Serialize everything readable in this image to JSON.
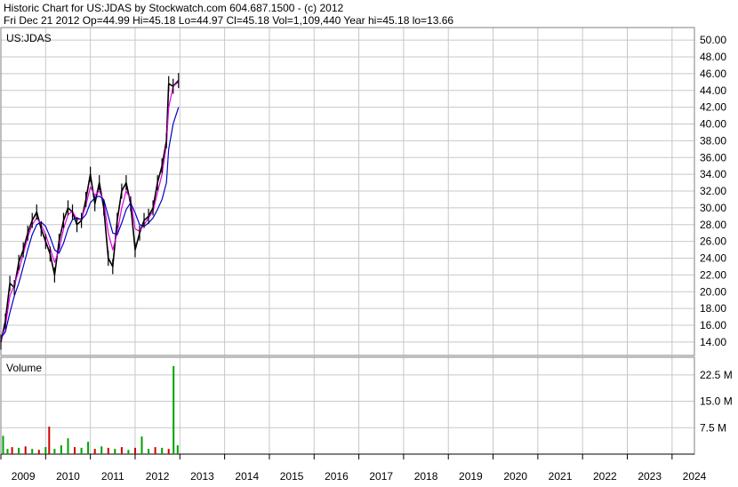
{
  "header": {
    "line1": "Historic Chart for US:JDAS by Stockwatch.com 604.687.1500 - (c) 2012",
    "line2": "Fri Dec 21 2012   Op=44.99  Hi=45.18  Lo=44.97  Cl=45.18  Vol=1,109,440   Year hi=45.18  lo=13.66"
  },
  "colors": {
    "grid": "#c8c8c8",
    "price": "#000000",
    "ma_short": "#e000e0",
    "ma_long": "#0000cc",
    "vol_up": "#00a000",
    "vol_down": "#d00000"
  },
  "chart_data": [
    {
      "type": "line",
      "panel_label": "US:JDAS",
      "x": [
        2009.0,
        2009.1,
        2009.2,
        2009.3,
        2009.4,
        2009.5,
        2009.6,
        2009.7,
        2009.8,
        2009.9,
        2010.0,
        2010.1,
        2010.2,
        2010.3,
        2010.4,
        2010.5,
        2010.6,
        2010.7,
        2010.8,
        2010.9,
        2011.0,
        2011.1,
        2011.2,
        2011.3,
        2011.4,
        2011.5,
        2011.6,
        2011.7,
        2011.8,
        2011.9,
        2012.0,
        2012.1,
        2012.2,
        2012.3,
        2012.4,
        2012.5,
        2012.6,
        2012.7,
        2012.75,
        2012.85,
        2012.97
      ],
      "series": [
        {
          "values": [
            14.0,
            16.5,
            21.0,
            20.5,
            23.5,
            25.0,
            27.0,
            28.5,
            29.5,
            27.5,
            26.0,
            24.5,
            22.0,
            26.0,
            28.5,
            30.0,
            29.5,
            28.0,
            28.5,
            31.0,
            34.0,
            30.5,
            33.0,
            30.0,
            24.0,
            23.0,
            28.5,
            32.0,
            33.0,
            30.5,
            25.0,
            27.0,
            28.5,
            29.0,
            30.0,
            33.0,
            35.0,
            38.0,
            44.8,
            44.5,
            45.18
          ]
        },
        {
          "values": [
            14.2,
            15.8,
            19.5,
            20.8,
            22.5,
            24.5,
            26.5,
            28.0,
            28.8,
            28.0,
            26.8,
            25.2,
            23.5,
            25.0,
            27.5,
            29.2,
            29.6,
            28.6,
            28.7,
            30.3,
            32.5,
            31.5,
            32.0,
            30.8,
            27.0,
            25.0,
            27.0,
            30.0,
            32.0,
            31.0,
            27.5,
            27.2,
            28.0,
            28.8,
            29.6,
            31.8,
            34.0,
            37.5,
            42.0,
            44.5,
            45.0
          ]
        },
        {
          "values": [
            14.5,
            15.2,
            17.5,
            19.5,
            21.0,
            23.0,
            25.0,
            26.8,
            28.0,
            28.3,
            27.8,
            26.5,
            25.0,
            24.6,
            25.8,
            27.5,
            28.6,
            28.8,
            28.6,
            29.2,
            30.6,
            31.2,
            31.4,
            31.0,
            29.0,
            27.0,
            26.8,
            28.2,
            29.8,
            30.6,
            29.4,
            28.0,
            27.8,
            28.2,
            28.8,
            29.8,
            31.0,
            33.0,
            37.0,
            40.0,
            42.0
          ]
        }
      ],
      "xlim": [
        2009.0,
        2024.5
      ],
      "ylim": [
        12.4,
        51.5
      ],
      "y_ticks": [
        "14.00",
        "16.00",
        "18.00",
        "20.00",
        "22.00",
        "24.00",
        "26.00",
        "28.00",
        "30.00",
        "32.00",
        "34.00",
        "36.00",
        "38.00",
        "40.00",
        "42.00",
        "44.00",
        "46.00",
        "48.00",
        "50.00"
      ],
      "x_ticks": [
        "2009",
        "2010",
        "2011",
        "2012",
        "2013",
        "2014",
        "2015",
        "2016",
        "2017",
        "2018",
        "2019",
        "2020",
        "2021",
        "2022",
        "2023",
        "2024"
      ],
      "grid": true
    },
    {
      "type": "bar",
      "panel_label": "Volume",
      "x": [
        2009.05,
        2009.15,
        2009.25,
        2009.4,
        2009.55,
        2009.7,
        2009.85,
        2010.0,
        2010.08,
        2010.2,
        2010.35,
        2010.5,
        2010.65,
        2010.8,
        2010.95,
        2011.1,
        2011.25,
        2011.4,
        2011.55,
        2011.7,
        2011.85,
        2012.0,
        2012.15,
        2012.3,
        2012.45,
        2012.6,
        2012.75,
        2012.86,
        2012.95
      ],
      "values": [
        5.2,
        1.5,
        2.0,
        1.8,
        2.2,
        1.5,
        1.2,
        2.0,
        7.8,
        1.5,
        2.5,
        4.5,
        2.0,
        1.8,
        3.5,
        1.5,
        2.2,
        1.8,
        1.5,
        2.0,
        1.2,
        1.8,
        5.0,
        1.5,
        2.0,
        1.8,
        1.5,
        25.0,
        2.5
      ],
      "up": [
        true,
        true,
        false,
        true,
        false,
        true,
        false,
        true,
        false,
        true,
        true,
        true,
        false,
        true,
        true,
        false,
        true,
        false,
        true,
        false,
        true,
        false,
        true,
        true,
        false,
        true,
        false,
        true,
        true
      ],
      "ylim": [
        0,
        27.5
      ],
      "y_ticks": [
        "7.5 M",
        "15.0 M",
        "22.5 M"
      ]
    }
  ]
}
